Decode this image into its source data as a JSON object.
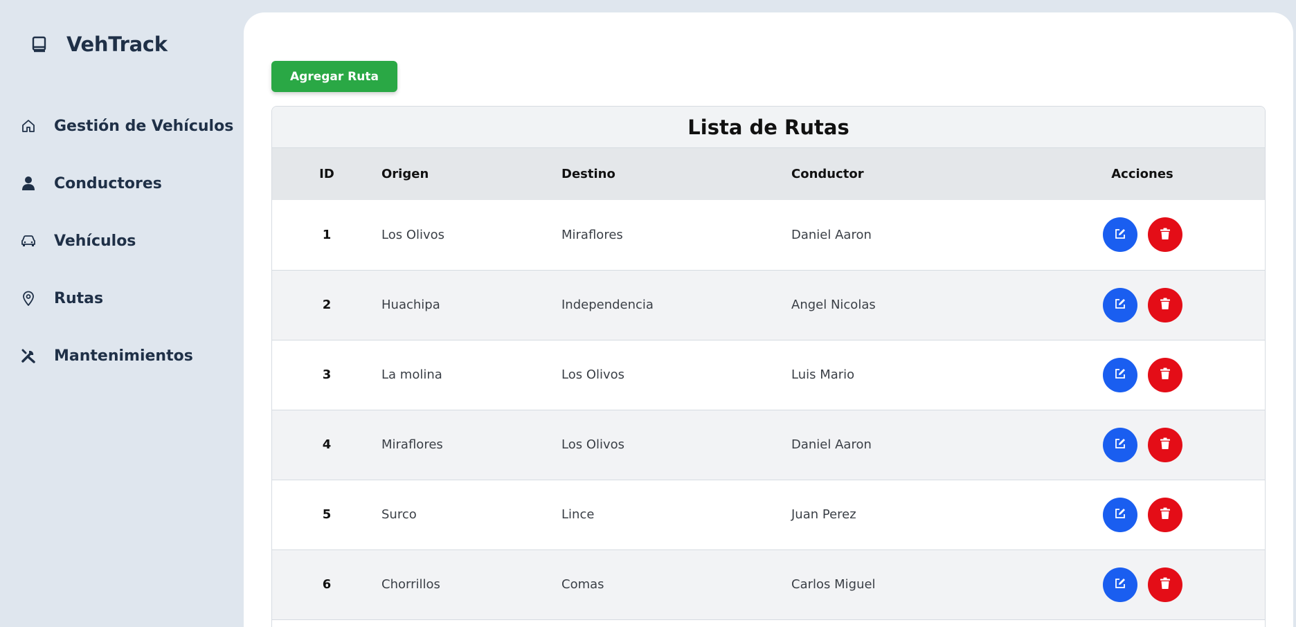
{
  "app": {
    "name": "VehTrack",
    "icon": "book-icon"
  },
  "sidebar": {
    "items": [
      {
        "label": "Gestión de Vehículos",
        "icon": "home-icon"
      },
      {
        "label": "Conductores",
        "icon": "user-icon"
      },
      {
        "label": "Vehículos",
        "icon": "car-icon"
      },
      {
        "label": "Rutas",
        "icon": "map-pin-icon"
      },
      {
        "label": "Mantenimientos",
        "icon": "tools-icon"
      }
    ]
  },
  "toolbar": {
    "add_label": "Agregar Ruta"
  },
  "table": {
    "title": "Lista de Rutas",
    "headers": {
      "id": "ID",
      "origen": "Origen",
      "destino": "Destino",
      "conductor": "Conductor",
      "acciones": "Acciones"
    },
    "rows": [
      {
        "id": "1",
        "origen": "Los Olivos",
        "destino": "Miraflores",
        "conductor": "Daniel Aaron"
      },
      {
        "id": "2",
        "origen": "Huachipa",
        "destino": "Independencia",
        "conductor": "Angel Nicolas"
      },
      {
        "id": "3",
        "origen": "La molina",
        "destino": "Los Olivos",
        "conductor": "Luis Mario"
      },
      {
        "id": "4",
        "origen": "Miraflores",
        "destino": "Los Olivos",
        "conductor": "Daniel Aaron"
      },
      {
        "id": "5",
        "origen": "Surco",
        "destino": "Lince",
        "conductor": "Juan Perez"
      },
      {
        "id": "6",
        "origen": "Chorrillos",
        "destino": "Comas",
        "conductor": "Carlos Miguel"
      }
    ],
    "row_actions": {
      "edit_icon": "edit-icon",
      "delete_icon": "trash-icon"
    }
  },
  "colors": {
    "accent_green": "#2aa845",
    "edit_blue": "#1a5ef0",
    "delete_red": "#e40d17",
    "sidebar_bg": "#dfe6ee",
    "text_dark": "#1f3047"
  }
}
